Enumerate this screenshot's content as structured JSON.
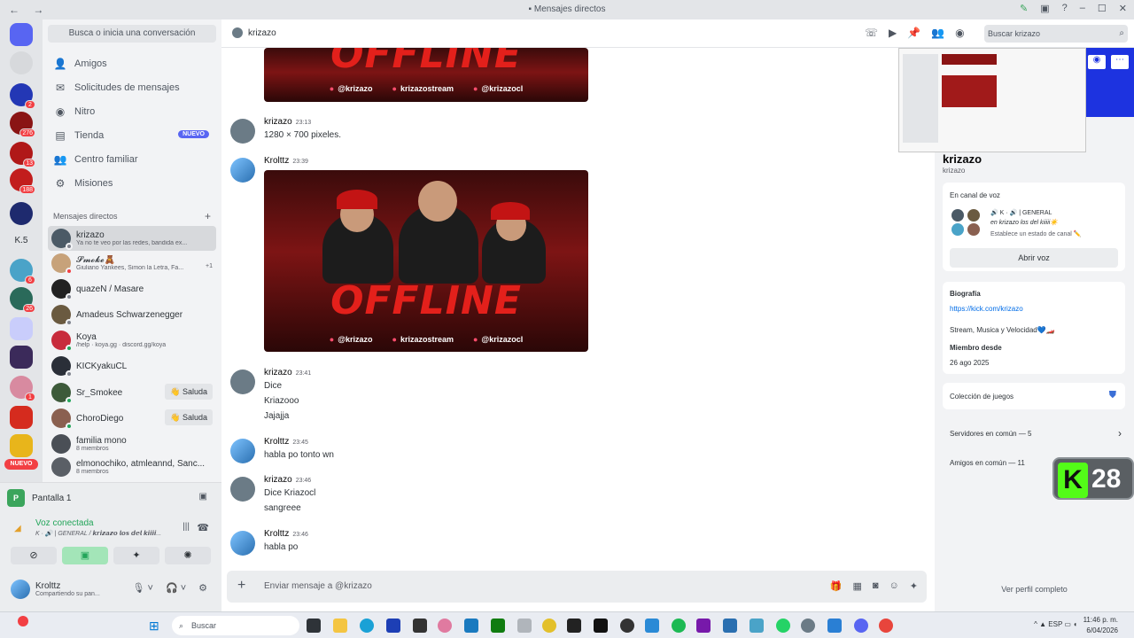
{
  "window": {
    "title": "Mensajes directos"
  },
  "servers": {
    "badges": [
      "2",
      "276",
      "13",
      "188",
      "6",
      "26",
      "1"
    ],
    "label_k5": "K.5",
    "nuevo": "NUEVO"
  },
  "sidebar": {
    "search_placeholder": "Busca o inicia una conversación",
    "nav": [
      {
        "label": "Amigos",
        "icon": "friends-icon"
      },
      {
        "label": "Solicitudes de mensajes",
        "icon": "envelope-icon"
      },
      {
        "label": "Nitro",
        "icon": "nitro-icon"
      },
      {
        "label": "Tienda",
        "icon": "shop-icon",
        "badge": "NUEVO"
      },
      {
        "label": "Centro familiar",
        "icon": "family-icon"
      },
      {
        "label": "Misiones",
        "icon": "quests-icon"
      }
    ],
    "dm_header": "Mensajes directos",
    "dms": [
      {
        "name": "krizazo",
        "sub": "Ya no te veo por las redes, bandida ex...",
        "status": "#80848e"
      },
      {
        "name": "𝓢𝓶𝓸𝓴𝓮🧸",
        "sub": "Giuliano Yankees, Simon la Letra, Fa...",
        "status": "#f23f43",
        "extra": "+1"
      },
      {
        "name": "quazeN / Masare",
        "sub": "",
        "status": "#80848e"
      },
      {
        "name": "Amadeus Schwarzenegger",
        "sub": "",
        "status": "#80848e"
      },
      {
        "name": "Koya",
        "sub": "/help · koya.gg · discord.gg/koya",
        "status": "#23a55a"
      },
      {
        "name": "KICKyakuCL",
        "sub": "",
        "status": "#80848e"
      },
      {
        "name": "Sr_Smokee",
        "sub": "",
        "status": "#23a55a",
        "saluda": "Saluda"
      },
      {
        "name": "ChoroDiego",
        "sub": "",
        "status": "#23a55a",
        "saluda": "Saluda"
      },
      {
        "name": "familia mono",
        "sub": "8 miembros",
        "status": ""
      },
      {
        "name": "elmonochiko, atmleannd, Sanc...",
        "sub": "8 miembros",
        "status": ""
      }
    ]
  },
  "voice": {
    "stream_label": "Pantalla 1",
    "connected": "Voz conectada",
    "channel": "K · 🔊 | GENERAL / 𝙠𝙧𝙞𝙯𝙖𝙯𝙤 𝙡𝙤𝙨 𝙙𝙚𝙡 𝙠𝙞𝙞𝙞𝙞..."
  },
  "user": {
    "name": "Krolttz",
    "status": "Compartiendo su pan..."
  },
  "chat": {
    "header_name": "krizazo",
    "search_placeholder": "Buscar krizazo",
    "banner_text": "OFFLINE",
    "socials": [
      "@krizazo",
      "krizazostream",
      "@krizazocl"
    ],
    "messages": [
      {
        "author": "krizazo",
        "time": "23:13",
        "lines": [
          "1280 × 700 pixeles."
        ]
      },
      {
        "author": "Krolttz",
        "time": "23:39",
        "lines": []
      },
      {
        "author": "krizazo",
        "time": "23:41",
        "lines": [
          "Dice",
          "Kriazooo",
          "Jajajja"
        ]
      },
      {
        "author": "Krolttz",
        "time": "23:45",
        "lines": [
          "habla po tonto wn"
        ]
      },
      {
        "author": "krizazo",
        "time": "23:46",
        "lines": [
          "Dice Kriazocl",
          "sangreee"
        ]
      },
      {
        "author": "Krolttz",
        "time": "23:46",
        "lines": [
          "habla po"
        ]
      }
    ],
    "composer_placeholder": "Enviar mensaje a @krizazo"
  },
  "profile": {
    "name": "krizazo",
    "username": "krizazo",
    "voice_title": "En canal de voz",
    "voice_channel": "🔊 K · 🔊 | GENERAL",
    "voice_server": "en krizazo los del kiiiii☀️",
    "voice_status": "Establece un estado de canal ✏️",
    "join_voice": "Abrir voz",
    "bio_title": "Biografía",
    "bio_link": "https://kick.com/krizazo",
    "bio_text": "Stream, Musica y Velocidad💙🏎️",
    "member_since_title": "Miembro desde",
    "member_since": "26 ago 2025",
    "games": "Colección de juegos",
    "servers_common": "Servidores en común — 5",
    "friends_common": "Amigos en común — 11",
    "kick_count": "28",
    "view_full": "Ver perfil completo"
  },
  "taskbar": {
    "search": "Buscar",
    "lang": "ESP",
    "time": "11:46 p. m.",
    "date": "6/04/2026"
  }
}
